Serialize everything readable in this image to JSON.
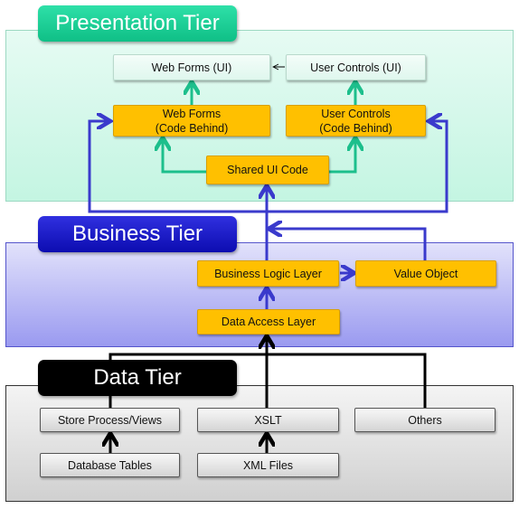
{
  "tiers": {
    "presentation": "Presentation Tier",
    "business": "Business Tier",
    "data": "Data Tier"
  },
  "presentation": {
    "web_forms_ui": "Web Forms (UI)",
    "user_controls_ui": "User Controls (UI)",
    "web_forms_cb_1": "Web Forms",
    "web_forms_cb_2": "(Code Behind)",
    "user_controls_cb_1": "User Controls",
    "user_controls_cb_2": "(Code Behind)",
    "shared_ui": "Shared UI Code"
  },
  "business": {
    "bll": "Business Logic Layer",
    "value_object": "Value Object",
    "dal": "Data Access Layer"
  },
  "data": {
    "store_process": "Store Process/Views",
    "xslt": "XSLT",
    "others": "Others",
    "db_tables": "Database Tables",
    "xml_files": "XML Files"
  },
  "colors": {
    "presentation": "#14c690",
    "business": "#1414c0",
    "data": "#000000",
    "component": "#ffc000",
    "teal_arrow": "#1dbf8c",
    "blue_arrow": "#3a3acc"
  }
}
